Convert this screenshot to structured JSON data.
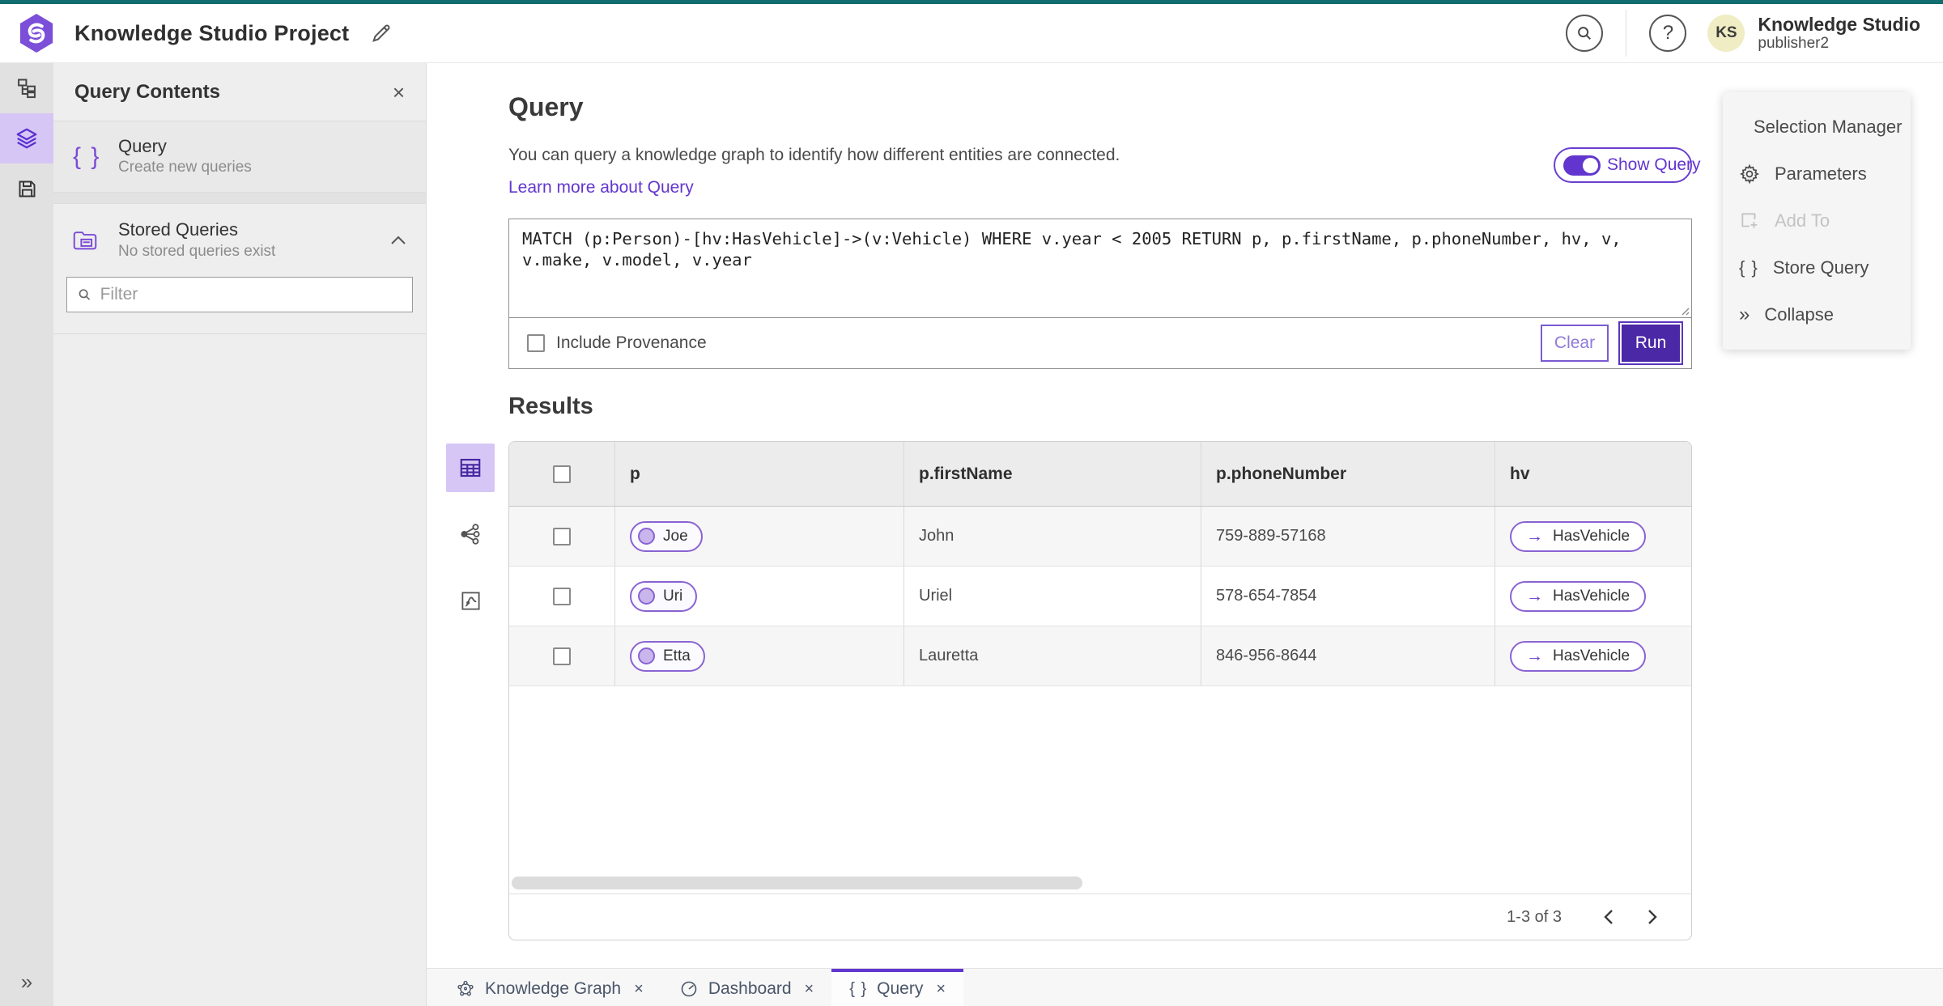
{
  "app": {
    "title": "Knowledge Studio Project",
    "product_name": "Knowledge Studio",
    "user_role": "publisher2",
    "avatar_initials": "KS",
    "help_glyph": "?"
  },
  "left_panel": {
    "title": "Query Contents",
    "close_glyph": "×",
    "query_item": {
      "title": "Query",
      "subtitle": "Create new queries"
    },
    "stored_queries": {
      "title": "Stored Queries",
      "subtitle": "No stored queries exist"
    },
    "filter_placeholder": "Filter"
  },
  "main": {
    "heading": "Query",
    "description": "You can query a knowledge graph to identify how different entities are connected.",
    "learn_more_link": "Learn more about Query",
    "show_query_label": "Show Query",
    "query_text": "MATCH (p:Person)-[hv:HasVehicle]->(v:Vehicle) WHERE v.year < 2005 RETURN p, p.firstName, p.phoneNumber, hv, v, v.make, v.model, v.year",
    "include_provenance_label": "Include Provenance",
    "clear_label": "Clear",
    "run_label": "Run",
    "results_heading": "Results"
  },
  "table": {
    "columns": [
      "p",
      "p.firstName",
      "p.phoneNumber",
      "hv"
    ],
    "rows": [
      {
        "p": "Joe",
        "firstName": "John",
        "phoneNumber": "759-889-57168",
        "hv_arrow": "→",
        "hv": "HasVehicle"
      },
      {
        "p": "Uri",
        "firstName": "Uriel",
        "phoneNumber": "578-654-7854",
        "hv_arrow": "→",
        "hv": "HasVehicle"
      },
      {
        "p": "Etta",
        "firstName": "Lauretta",
        "phoneNumber": "846-956-8644",
        "hv_arrow": "→",
        "hv": "HasVehicle"
      }
    ],
    "pagination": "1-3 of 3"
  },
  "right_menu": {
    "items": [
      {
        "label": "Selection Manager"
      },
      {
        "label": "Parameters"
      },
      {
        "label": "Add To"
      },
      {
        "label": "Store Query"
      },
      {
        "label": "Collapse"
      }
    ],
    "collapse_glyph": "»",
    "braces_glyph": "{ }"
  },
  "tabs": [
    {
      "label": "Knowledge Graph",
      "close_glyph": "×"
    },
    {
      "label": "Dashboard",
      "close_glyph": "×"
    },
    {
      "label": "Query",
      "close_glyph": "×",
      "braces_glyph": "{ }"
    }
  ],
  "rail": {
    "expand_glyph": "»"
  },
  "panel_glyphs": {
    "braces": "{ }",
    "chevron_note": "collapse-section"
  },
  "colors": {
    "accent_purple": "#6236ce",
    "deep_purple": "#4b28a5",
    "light_purple_bg": "#d6c6f5",
    "pill_border": "#8a63d2",
    "teal_topline": "#116d70",
    "avatar_bg": "#f0ecc4",
    "panel_bg": "#eeeeee",
    "rail_bg": "#e1e1e1"
  }
}
